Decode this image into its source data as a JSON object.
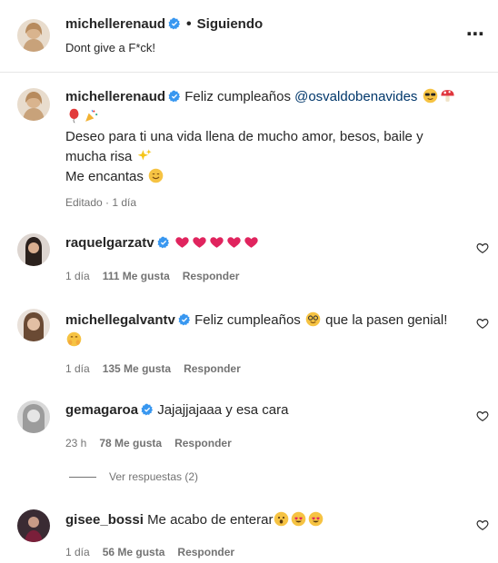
{
  "post": {
    "author": "michellerenaud",
    "separator": "•",
    "follow_label": "Siguiendo",
    "caption": "Dont give a F*ck!",
    "more_icon": "⋯"
  },
  "comments": [
    {
      "user": "michellerenaud",
      "text_before": "Feliz cumpleaños ",
      "mention": "@osvaldobenavides",
      "line2": "Deseo para ti una vida llena de mucho amor, besos, baile y",
      "line3": "mucha risa",
      "line4": "Me encantas",
      "meta_time": "Editado · 1 día"
    },
    {
      "user": "raquelgarzatv",
      "time": "1 día",
      "likes": "111 Me gusta",
      "reply": "Responder"
    },
    {
      "user": "michellegalvantv",
      "text_before": "Feliz cumpleaños ",
      "text_after": " que la pasen genial!",
      "time": "1 día",
      "likes": "135 Me gusta",
      "reply": "Responder"
    },
    {
      "user": "gemagaroa",
      "text": "Jajajjajaaa y esa cara",
      "time": "23 h",
      "likes": "78 Me gusta",
      "reply": "Responder"
    },
    {
      "user": "gisee_bossi",
      "text": "Me acabo de enterar",
      "time": "1 día",
      "likes": "56 Me gusta",
      "reply": "Responder"
    }
  ],
  "view_replies": "Ver respuestas (2)",
  "colors": {
    "verified": "#3897f0",
    "heart_red": "#e0245e",
    "muted": "#737373",
    "link": "#00376b"
  }
}
